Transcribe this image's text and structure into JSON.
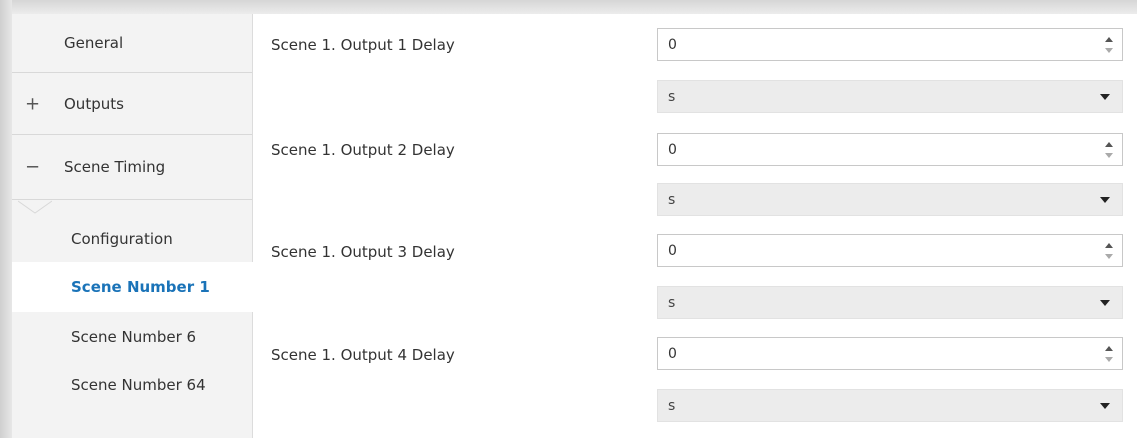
{
  "sidebar": {
    "items": [
      {
        "label": "General",
        "toggle": ""
      },
      {
        "label": "Outputs",
        "toggle": "+"
      },
      {
        "label": "Scene Timing",
        "toggle": "−"
      }
    ],
    "subitems": [
      {
        "label": "Configuration"
      },
      {
        "label": "Scene Number 1"
      },
      {
        "label": "Scene Number 6"
      },
      {
        "label": "Scene Number 64"
      }
    ],
    "active_color": "#1a73b8"
  },
  "content": {
    "rows": [
      {
        "label": "Scene 1. Output 1 Delay",
        "value": "0",
        "unit": "s"
      },
      {
        "label": "Scene 1. Output 2 Delay",
        "value": "0",
        "unit": "s"
      },
      {
        "label": "Scene 1. Output 3 Delay",
        "value": "0",
        "unit": "s"
      },
      {
        "label": "Scene 1. Output 4 Delay",
        "value": "0",
        "unit": "s"
      }
    ]
  }
}
